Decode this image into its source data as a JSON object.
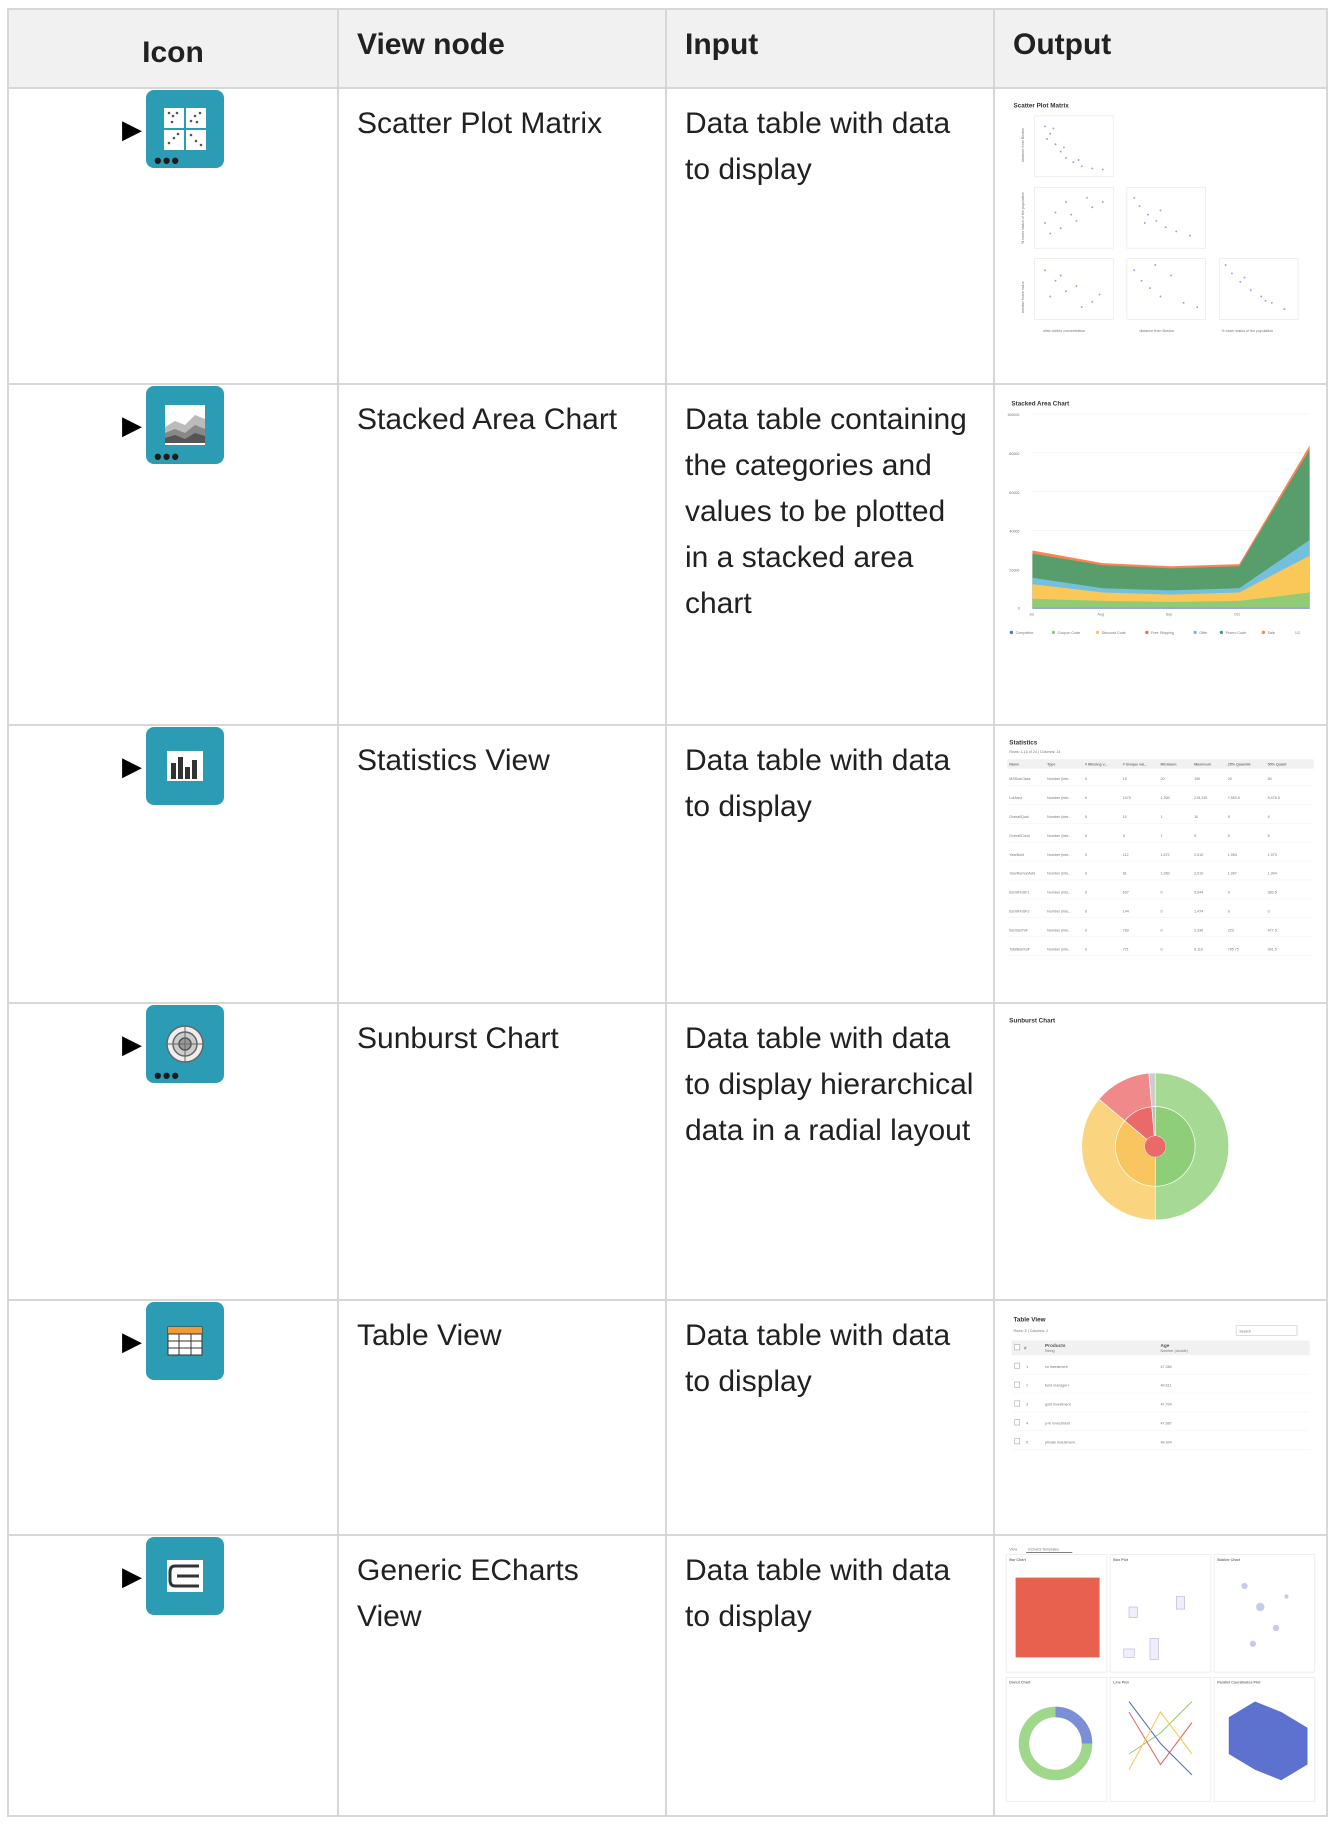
{
  "headers": {
    "icon": "Icon",
    "view_node": "View node",
    "input": "Input",
    "output": "Output"
  },
  "rows": [
    {
      "name": "Scatter Plot Matrix",
      "input": "Data table with data to display",
      "icon": "scatter-matrix-icon",
      "thumb": {
        "title": "Scatter Plot Matrix",
        "y_labels": [
          "distance from Boston",
          "% lower status of the population",
          "median home value"
        ],
        "x_labels": [
          "nitric oxides concentration",
          "distance from Boston",
          "% lower status of the population"
        ]
      }
    },
    {
      "name": "Stacked Area Chart",
      "input": "Data table containing the categories and values to be plotted in a stacked area chart",
      "icon": "stacked-area-icon",
      "thumb": {
        "title": "Stacked Area Chart",
        "y_ticks": [
          "100000",
          "80000",
          "60000",
          "40000",
          "20000",
          "0"
        ],
        "x_ticks": [
          "Jul",
          "Aug",
          "Sep",
          "Oct"
        ],
        "legend": [
          "Competitor",
          "Coupon Code",
          "Discount Code",
          "Free Shipping",
          "Offer",
          "Promo Code",
          "Sale"
        ],
        "pager": "1/2"
      }
    },
    {
      "name": "Statistics View",
      "input": "Data table with data to display",
      "icon": "statistics-icon",
      "thumb": {
        "title": "Statistics",
        "subtitle": "Rows: 1-10 of 24  |  Columns: 14",
        "columns": [
          "Name",
          "Type",
          "# Missing v...",
          "# Unique val...",
          "Minimum",
          "Maximum",
          "25% Quantile",
          "50% Quant"
        ],
        "rows": [
          [
            "MSSubClass",
            "Number (inte...",
            "0",
            "15",
            "20",
            "190",
            "20",
            "50"
          ],
          [
            "LotArea",
            "Number (inte...",
            "0",
            "1073",
            "1,300",
            "215,245",
            "7,553.5",
            "9,478.5"
          ],
          [
            "OverallQual",
            "Number (inte...",
            "0",
            "10",
            "1",
            "10",
            "5",
            "6"
          ],
          [
            "OverallCond",
            "Number (inte...",
            "0",
            "9",
            "1",
            "9",
            "5",
            "5"
          ],
          [
            "YearBuilt",
            "Number (inte...",
            "0",
            "112",
            "1,872",
            "2,010",
            "1,954",
            "1,973"
          ],
          [
            "YearRemodAdd",
            "Number (inte...",
            "0",
            "61",
            "1,950",
            "2,010",
            "1,967",
            "1,994"
          ],
          [
            "BsmtFinSF1",
            "Number (inte...",
            "0",
            "637",
            "0",
            "5,644",
            "0",
            "383.5"
          ],
          [
            "BsmtFinSF2",
            "Number (inte...",
            "0",
            "144",
            "0",
            "1,474",
            "0",
            "0"
          ],
          [
            "BsmtUnfSF",
            "Number (inte...",
            "0",
            "780",
            "0",
            "2,336",
            "223",
            "477.5"
          ],
          [
            "TotalBsmtSF",
            "Number (inte...",
            "0",
            "721",
            "0",
            "6,110",
            "795.75",
            "991.5"
          ]
        ]
      }
    },
    {
      "name": "Sunburst Chart",
      "input": "Data table with data to display hierarchical data in a radial layout",
      "icon": "sunburst-icon",
      "thumb": {
        "title": "Sunburst Chart"
      }
    },
    {
      "name": "Table View",
      "input": "Data table with data to display",
      "icon": "table-icon",
      "thumb": {
        "title": "Table View",
        "subtitle": "Rows: 5  |  Columns: 2",
        "search_placeholder": "Search",
        "col1": "Products",
        "col1_type": "String",
        "col2": "Age",
        "col2_type": "Number (double)",
        "rows": [
          [
            "1",
            "co investment",
            "47.284"
          ],
          [
            "2",
            "fund manager+",
            "48.611"
          ],
          [
            "3",
            "gold investment",
            "47.704"
          ],
          [
            "4",
            "p+b investment",
            "47.687"
          ],
          [
            "5",
            "private investment",
            "48.924"
          ]
        ]
      }
    },
    {
      "name": "Generic ECharts View",
      "input": "Data table with data to display",
      "icon": "echarts-icon",
      "thumb": {
        "tabs": [
          "View",
          "ECharts Templates"
        ],
        "panels": [
          "Bar Chart",
          "Box Plot",
          "Bubble Chart",
          "Donut Chart",
          "Line Plot",
          "Parallel Coordinates Plot"
        ]
      }
    }
  ],
  "colors": {
    "tile": "#2b9cb4",
    "header_bg": "#f1f1f1",
    "border": "#d7d7d7",
    "legend": [
      "#5470c6",
      "#91cc75",
      "#fac858",
      "#ee6666",
      "#73c0de",
      "#3ba272",
      "#fc8452"
    ]
  }
}
